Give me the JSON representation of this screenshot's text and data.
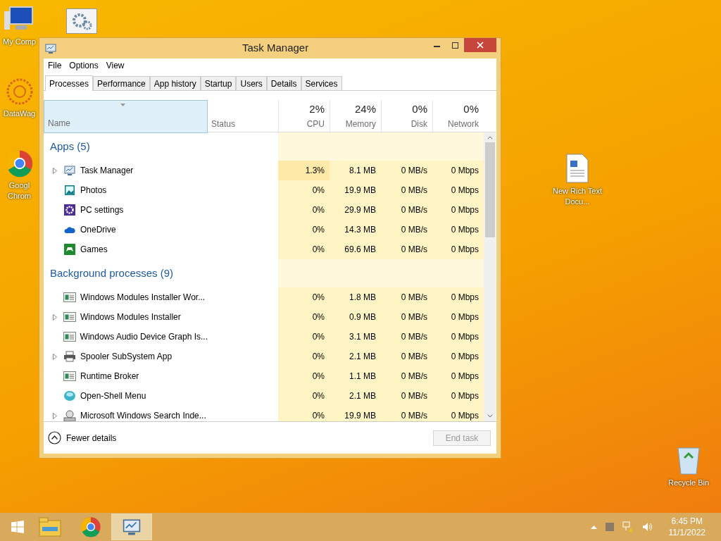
{
  "desktop_icons": [
    {
      "label": "My Comp"
    },
    {
      "label": "DataWag"
    },
    {
      "label": "Googl Chrom"
    },
    {
      "label": "New Rich Text Docu..."
    },
    {
      "label": "Recycle Bin"
    }
  ],
  "window": {
    "title": "Task Manager",
    "menu": [
      "File",
      "Options",
      "View"
    ],
    "tabs": [
      {
        "label": "Processes",
        "selected": true
      },
      {
        "label": "Performance",
        "selected": false
      },
      {
        "label": "App history",
        "selected": false
      },
      {
        "label": "Startup",
        "selected": false
      },
      {
        "label": "Users",
        "selected": false
      },
      {
        "label": "Details",
        "selected": false
      },
      {
        "label": "Services",
        "selected": false
      }
    ],
    "columns": [
      {
        "label": "Name",
        "selected": true
      },
      {
        "label": "Status",
        "selected": false
      },
      {
        "label": "CPU",
        "total": "2%",
        "selected": false
      },
      {
        "label": "Memory",
        "total": "24%",
        "selected": false
      },
      {
        "label": "Disk",
        "total": "0%",
        "selected": false
      },
      {
        "label": "Network",
        "total": "0%",
        "selected": false
      }
    ],
    "groups": [
      {
        "title": "Apps (5)",
        "rows": [
          {
            "name": "Task Manager",
            "expandable": true,
            "cpu": "1.3%",
            "memory": "8.1 MB",
            "disk": "0 MB/s",
            "network": "0 Mbps"
          },
          {
            "name": "Photos",
            "expandable": false,
            "cpu": "0%",
            "memory": "19.9 MB",
            "disk": "0 MB/s",
            "network": "0 Mbps"
          },
          {
            "name": "PC settings",
            "expandable": false,
            "cpu": "0%",
            "memory": "29.9 MB",
            "disk": "0 MB/s",
            "network": "0 Mbps"
          },
          {
            "name": "OneDrive",
            "expandable": false,
            "cpu": "0%",
            "memory": "14.3 MB",
            "disk": "0 MB/s",
            "network": "0 Mbps"
          },
          {
            "name": "Games",
            "expandable": false,
            "cpu": "0%",
            "memory": "69.6 MB",
            "disk": "0 MB/s",
            "network": "0 Mbps"
          }
        ]
      },
      {
        "title": "Background processes (9)",
        "rows": [
          {
            "name": "Windows Modules Installer Wor...",
            "expandable": false,
            "cpu": "0%",
            "memory": "1.8 MB",
            "disk": "0 MB/s",
            "network": "0 Mbps"
          },
          {
            "name": "Windows Modules Installer",
            "expandable": true,
            "cpu": "0%",
            "memory": "0.9 MB",
            "disk": "0 MB/s",
            "network": "0 Mbps"
          },
          {
            "name": "Windows Audio Device Graph Is...",
            "expandable": false,
            "cpu": "0%",
            "memory": "3.1 MB",
            "disk": "0 MB/s",
            "network": "0 Mbps"
          },
          {
            "name": "Spooler SubSystem App",
            "expandable": true,
            "cpu": "0%",
            "memory": "2.1 MB",
            "disk": "0 MB/s",
            "network": "0 Mbps"
          },
          {
            "name": "Runtime Broker",
            "expandable": false,
            "cpu": "0%",
            "memory": "1.1 MB",
            "disk": "0 MB/s",
            "network": "0 Mbps"
          },
          {
            "name": "Open-Shell Menu",
            "expandable": false,
            "cpu": "0%",
            "memory": "2.1 MB",
            "disk": "0 MB/s",
            "network": "0 Mbps"
          },
          {
            "name": "Microsoft Windows Search Inde...",
            "expandable": true,
            "cpu": "0%",
            "memory": "19.9 MB",
            "disk": "0 MB/s",
            "network": "0 Mbps"
          }
        ]
      }
    ],
    "fewer_details": "Fewer details",
    "end_task": {
      "label": "End task",
      "disabled": true
    }
  },
  "taskbar": {
    "items": [
      {
        "selected": false
      },
      {
        "selected": false
      },
      {
        "selected": false
      },
      {
        "selected": true
      }
    ],
    "time": "6:45 PM",
    "date": "11/1/2022"
  }
}
